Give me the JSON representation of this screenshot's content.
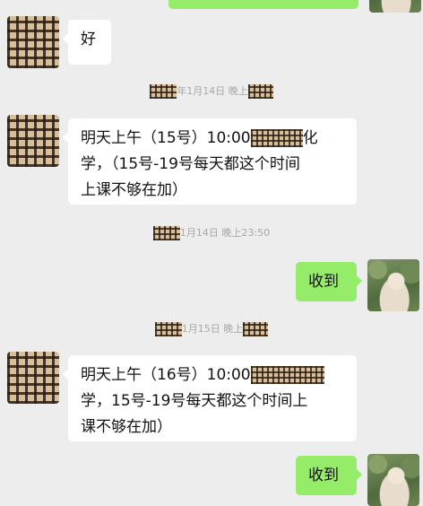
{
  "messages": [
    {
      "id": "msg-1",
      "side": "in",
      "lines": [
        "好"
      ]
    },
    {
      "id": "msg-2",
      "side": "in",
      "lines": [
        "明天上午（15号）10:00",
        "学，（15号-19号每天都这个时间",
        "上课不够在加）"
      ],
      "redacted_tail": "化"
    },
    {
      "id": "msg-3",
      "side": "out",
      "lines": [
        "收到"
      ]
    },
    {
      "id": "msg-4",
      "side": "in",
      "lines": [
        "明天上午（16号）10:00",
        "学，15号-19号每天都这个时间上",
        "课不够在加）"
      ]
    },
    {
      "id": "msg-5",
      "side": "out",
      "lines": [
        "收到"
      ]
    }
  ],
  "timestamps": [
    {
      "date": "年1月14日",
      "time": "晚上"
    },
    {
      "date": "1月14日",
      "time": "晚上23:50"
    },
    {
      "date": "1月15日",
      "time": "晚上"
    }
  ]
}
